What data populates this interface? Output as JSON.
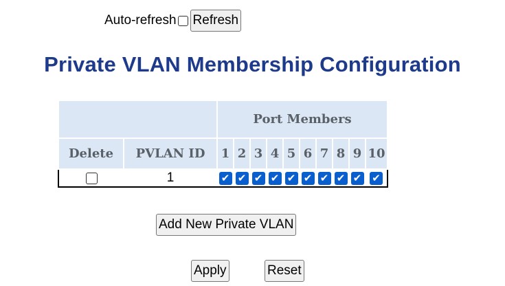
{
  "header": {
    "auto_refresh_label": "Auto-refresh",
    "auto_refresh_checked": false,
    "refresh_button": "Refresh"
  },
  "page_title": "Private VLAN Membership Configuration",
  "table": {
    "group_header": "Port Members",
    "columns": {
      "delete": "Delete",
      "pvlan_id": "PVLAN ID",
      "ports": [
        "1",
        "2",
        "3",
        "4",
        "5",
        "6",
        "7",
        "8",
        "9",
        "10"
      ]
    },
    "rows": [
      {
        "delete_checked": false,
        "pvlan_id": "1",
        "members": [
          true,
          true,
          true,
          true,
          true,
          true,
          true,
          true,
          true,
          true
        ]
      }
    ]
  },
  "buttons": {
    "add_new": "Add New Private VLAN",
    "apply": "Apply",
    "reset": "Reset"
  },
  "colors": {
    "title": "#1e3a8a",
    "header_bg": "#dbe7f5",
    "checkbox_checked": "#0a5fcf"
  }
}
